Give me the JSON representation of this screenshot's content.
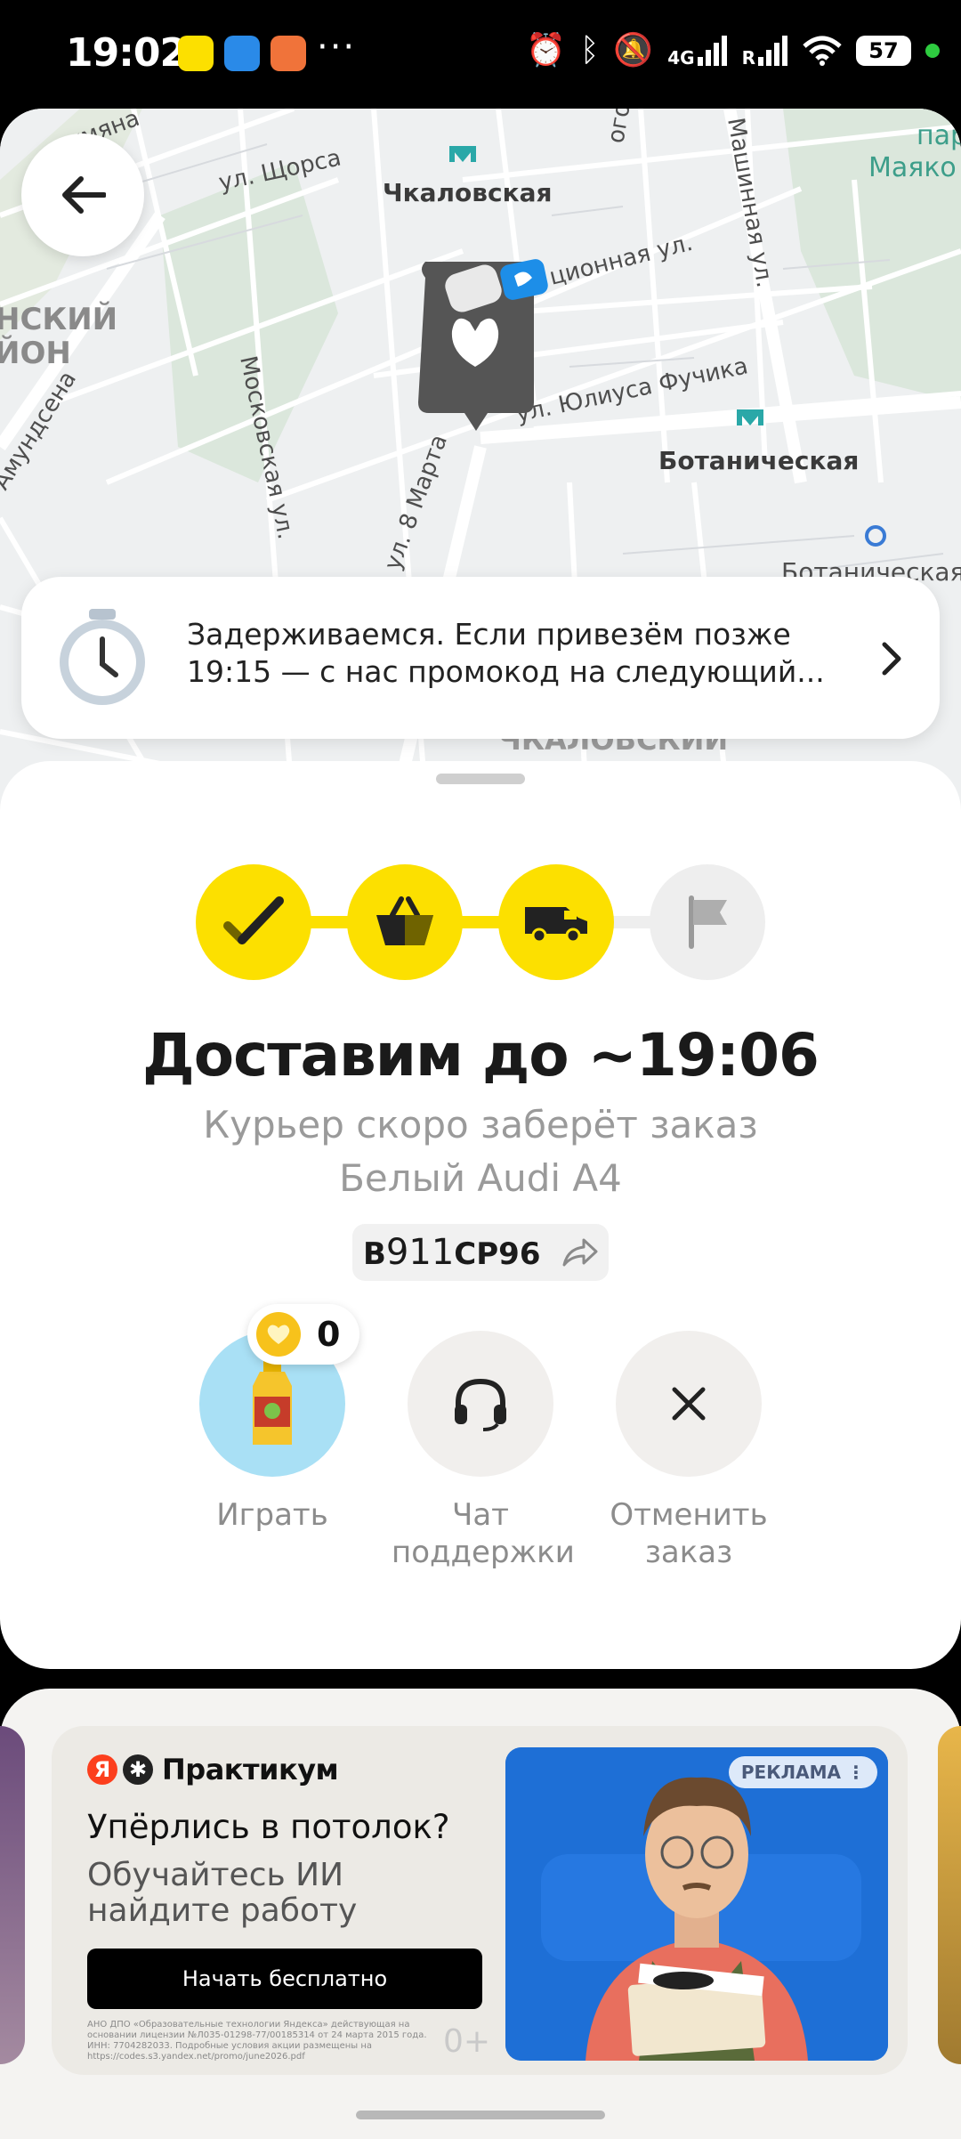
{
  "status_bar": {
    "time": "19:02",
    "dots": "···",
    "network_4g": "4G",
    "roaming": "R",
    "battery": "57",
    "icons": [
      "alarm-icon",
      "bluetooth-icon",
      "mute-icon",
      "signal-icon",
      "wifi-icon"
    ]
  },
  "map": {
    "streets": [
      "ул. Щорса",
      "ул. Юлиуса Фучика",
      "Московская ул.",
      "Машинная ул.",
      "ул. 8 Марта",
      "ционная ул.",
      "Амундсена",
      "умяна",
      "ого"
    ],
    "stations": [
      "Чкаловская",
      "Ботаническая"
    ],
    "districts": [
      "НСКИЙ",
      "ЙОН",
      "ЧКАЛОВСКИЙ",
      "Ботаническая"
    ],
    "park_labels": [
      "пар",
      "Маяко"
    ]
  },
  "delay_banner": {
    "line1": "Задерживаемся. Если привезём позже",
    "line2": "19:15 — с нас промокод на следующий..."
  },
  "order": {
    "eta_title": "Доставим до ~19:06",
    "status": "Курьер скоро заберёт заказ",
    "car": "Белый Audi A4",
    "plate_letter1": "В",
    "plate_number": "911",
    "plate_letters2": "СР",
    "plate_region": "96",
    "steps_completed": 3,
    "steps_total": 4,
    "colors": {
      "accent": "#fce000",
      "inactive": "#eeeeee"
    }
  },
  "actions": {
    "coins": "0",
    "play": "Играть",
    "support_line1": "Чат",
    "support_line2": "поддержки",
    "cancel_line1": "Отменить",
    "cancel_line2": "заказ"
  },
  "ad": {
    "brand_ya": "Я",
    "brand_name": "Практикум",
    "title": "Упёрлись в потолок?",
    "subtitle": "Обучайтесь ИИ найдите работу",
    "cta": "Начать бесплатно",
    "legal": "АНО ДПО «Образовательные технологии Яндекса» действующая на основании лицензии №Л035-01298-77/00185314 от 24 марта 2015 года. ИНН: 7704282033. Подробные условия акции размещены на https://codes.s3.yandex.net/promo/june2026.pdf",
    "age": "0+",
    "tag": "РЕКЛАМА ⋮"
  }
}
